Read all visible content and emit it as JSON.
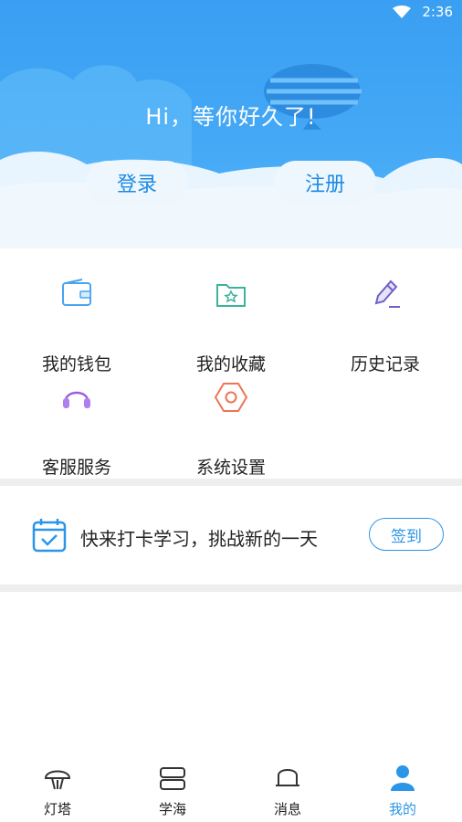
{
  "status_bar": {
    "time": "2:36"
  },
  "header": {
    "greeting": "Hi，等你好久了!",
    "login_label": "登录",
    "register_label": "注册"
  },
  "menu": {
    "items": [
      {
        "label": "我的钱包",
        "icon": "wallet-icon"
      },
      {
        "label": "我的收藏",
        "icon": "favorites-folder-icon"
      },
      {
        "label": "历史记录",
        "icon": "pen-edit-icon"
      },
      {
        "label": "客服服务",
        "icon": "headset-icon"
      },
      {
        "label": "系统设置",
        "icon": "settings-hex-icon"
      }
    ]
  },
  "checkin": {
    "text": "快来打卡学习，挑战新的一天",
    "button_label": "签到",
    "icon": "calendar-check-icon"
  },
  "tabbar": {
    "tabs": [
      {
        "label": "灯塔",
        "icon": "lighthouse-icon"
      },
      {
        "label": "学海",
        "icon": "books-icon"
      },
      {
        "label": "消息",
        "icon": "message-icon"
      },
      {
        "label": "我的",
        "icon": "user-icon"
      }
    ],
    "active_index": 3
  },
  "colors": {
    "header_blue": "#44a8f6",
    "accent": "#2b95e8",
    "button_bg": "#eef7fd"
  }
}
